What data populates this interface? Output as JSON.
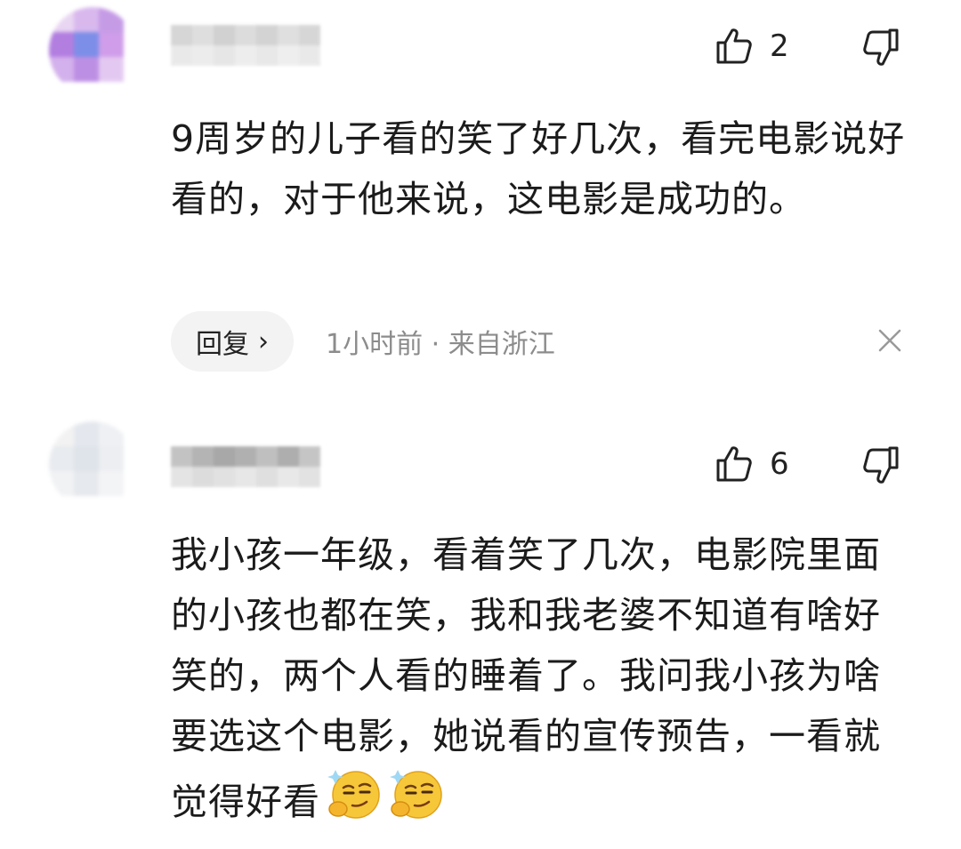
{
  "comments": [
    {
      "avatar": "blurred-avatar",
      "username": "",
      "likes": "2",
      "text": "9周岁的儿子看的笑了好几次，看完电影说好看的，对于他来说，这电影是成功的。",
      "reply_label": "回复",
      "reply_chevron": "›",
      "time": "1小时前",
      "separator": " · ",
      "location": "来自浙江",
      "close_icon": "close-icon"
    },
    {
      "avatar": "blurred-avatar",
      "username": "",
      "likes": "6",
      "text": "我小孩一年级，看着笑了几次，电影院里面的小孩也都在笑，我和我老婆不知道有啥好笑的，两个人看的睡着了。我问我小孩为啥要选这个电影，她说看的宣传预告，一看就觉得好看",
      "emojis": [
        "smug-thinking-emoji",
        "smug-thinking-emoji"
      ]
    }
  ],
  "icons": {
    "like": "thumbs-up-icon",
    "dislike": "thumbs-down-icon"
  },
  "colors": {
    "text": "#1b1b1b",
    "meta": "#8c8c8c",
    "reply_bg": "#f3f3f3",
    "emoji_face": "#f7c73a"
  }
}
